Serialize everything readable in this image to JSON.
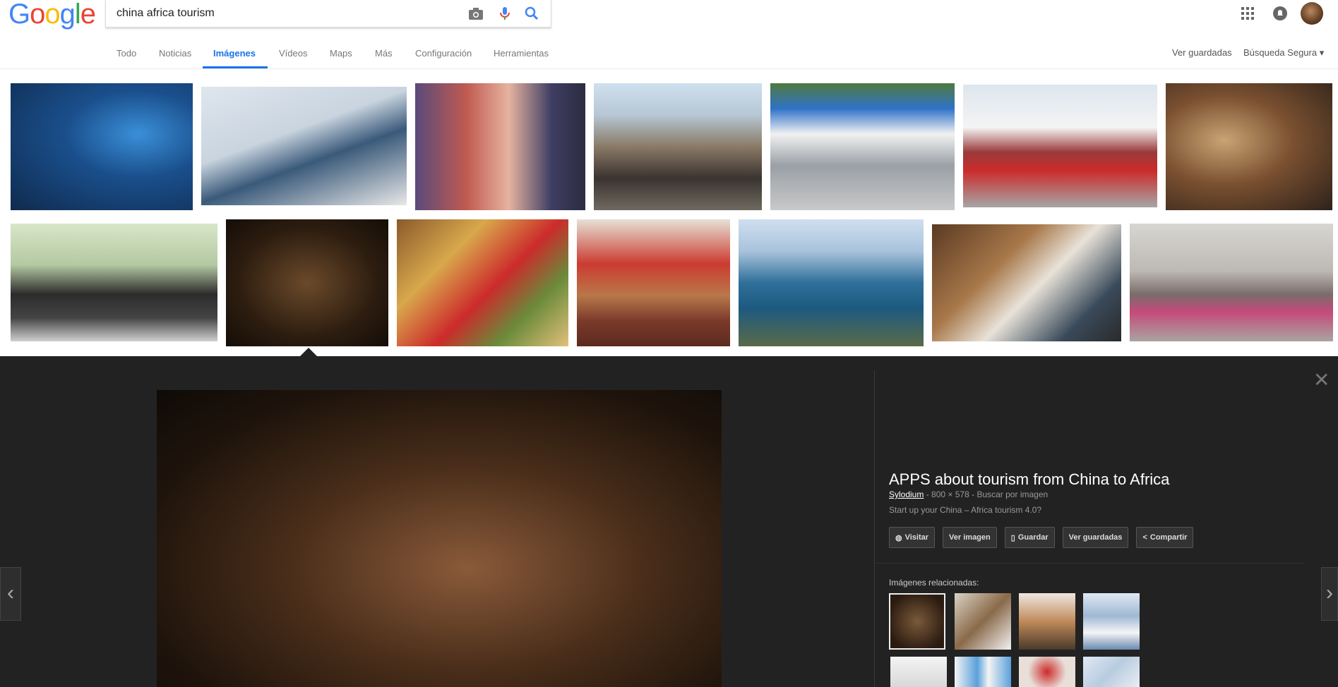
{
  "logo": {
    "letters": [
      "G",
      "o",
      "o",
      "g",
      "l",
      "e"
    ]
  },
  "search": {
    "query": "china africa tourism"
  },
  "tabs": [
    "Todo",
    "Noticias",
    "Imágenes",
    "Vídeos",
    "Maps",
    "Más",
    "Configuración",
    "Herramientas"
  ],
  "active_tab": "Imágenes",
  "right_links": {
    "saved": "Ver guardadas",
    "safe_search": "Búsqueda Segura"
  },
  "preview": {
    "title": "APPS about tourism from China to Africa",
    "source": "Sylodium",
    "dimensions": "800 × 578",
    "search_by_image": "Buscar por imagen",
    "description": "Start up your China – Africa tourism 4.0?",
    "actions": [
      "Visitar",
      "Ver imagen",
      "Guardar",
      "Ver guardadas",
      "Compartir"
    ],
    "related_label": "Imágenes relacionadas:"
  },
  "colors": {
    "accent": "#1a73e8",
    "panel_bg": "#222222"
  }
}
